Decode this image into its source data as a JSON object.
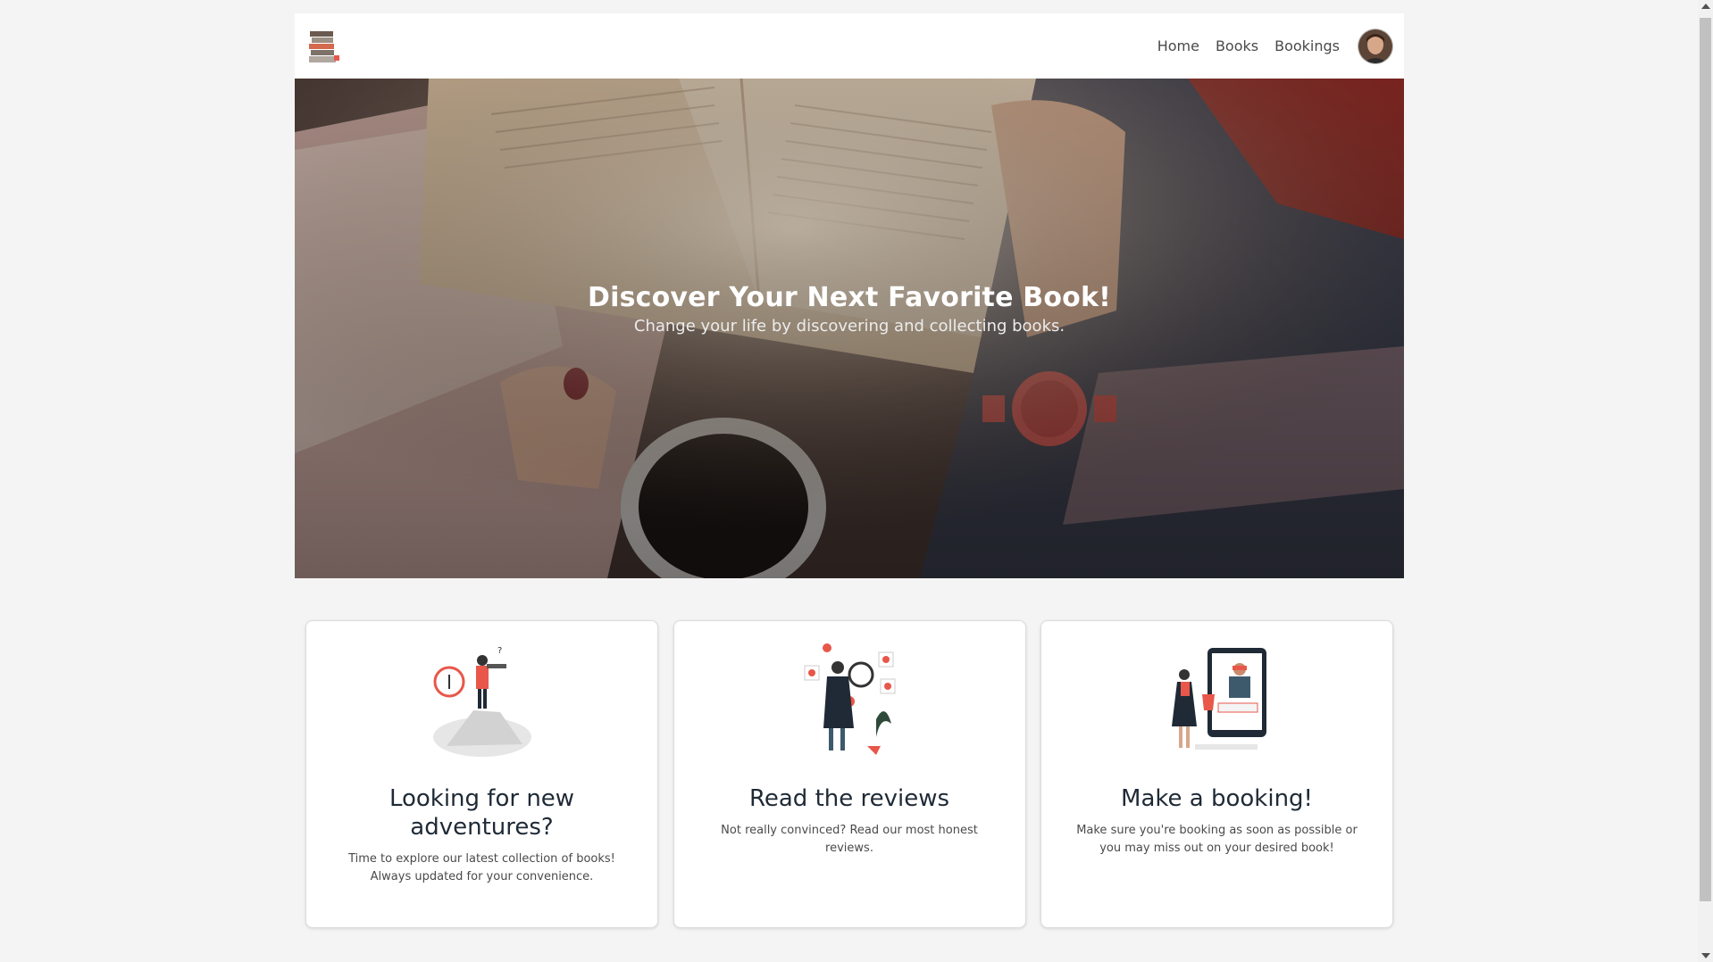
{
  "nav": {
    "logo_icon": "book-stack-icon",
    "links": [
      "Home",
      "Books",
      "Bookings"
    ],
    "avatar_icon": "user-avatar"
  },
  "hero": {
    "title": "Discover Your Next Favorite Book!",
    "subtitle": "Change your life by discovering and collecting books."
  },
  "cards": [
    {
      "title": "Looking for new adventures?",
      "text": "Time to explore our latest collection of books! Always updated for your convenience.",
      "icon": "explorer-illustration"
    },
    {
      "title": "Read the reviews",
      "text": "Not really convinced? Read our most honest reviews.",
      "icon": "reviews-illustration"
    },
    {
      "title": "Make a booking!",
      "text": "Make sure you're booking as soon as possible or you may miss out on your desired book!",
      "icon": "booking-illustration"
    }
  ],
  "colors": {
    "accent": "#e8574a",
    "background": "#f4f4f4",
    "card": "#ffffff",
    "text": "#1f2a36"
  }
}
